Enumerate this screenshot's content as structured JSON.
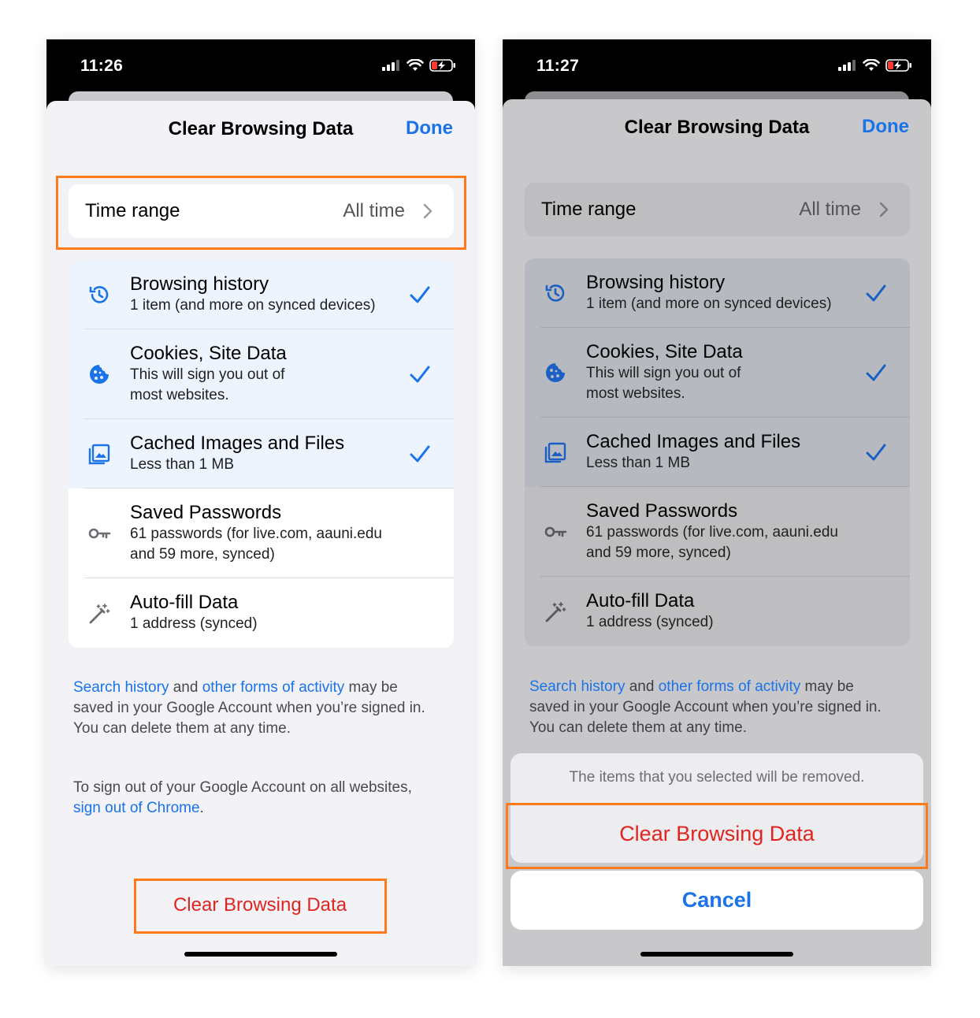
{
  "colors": {
    "accent_blue": "#1a73e8",
    "destructive_red": "#e0241f",
    "highlight_orange": "#ff7a1a"
  },
  "left": {
    "status": {
      "time": "11:26"
    },
    "header": {
      "title": "Clear Browsing Data",
      "done_label": "Done"
    },
    "time_range": {
      "label": "Time range",
      "value": "All time",
      "icon": "chevron-right-icon"
    },
    "items": [
      {
        "title": "Browsing history",
        "subtitle_lines": [
          "1 item (and more on synced devices)"
        ],
        "icon": "history-icon",
        "checked": true
      },
      {
        "title": "Cookies, Site Data",
        "subtitle_lines": [
          "This will sign you out of",
          "most websites."
        ],
        "icon": "cookie-icon",
        "checked": true
      },
      {
        "title": "Cached Images and Files",
        "subtitle_lines": [
          "Less than 1 MB"
        ],
        "icon": "image-icon",
        "checked": true
      },
      {
        "title": "Saved Passwords",
        "subtitle_lines": [
          "61 passwords (for live.com, aauni.edu",
          "and 59 more, synced)"
        ],
        "icon": "key-icon",
        "checked": false
      },
      {
        "title": "Auto-fill Data",
        "subtitle_lines": [
          "1 address (synced)"
        ],
        "icon": "magic-wand-icon",
        "checked": false
      }
    ],
    "footer": {
      "link1": "Search history",
      "and": " and ",
      "link2": "other forms of activity",
      "rest1": " may be",
      "line2": "saved in your Google Account when you’re signed in.",
      "line3": "You can delete them at any time.",
      "signout_line1": "To sign out of your Google Account on all websites,",
      "signout_link": "sign out of Chrome",
      "signout_end": "."
    },
    "clear_button": "Clear Browsing Data"
  },
  "right": {
    "status": {
      "time": "11:27"
    },
    "header": {
      "title": "Clear Browsing Data",
      "done_label": "Done"
    },
    "time_range": {
      "label": "Time range",
      "value": "All time",
      "icon": "chevron-right-icon"
    },
    "items": [
      {
        "title": "Browsing history",
        "subtitle_lines": [
          "1 item (and more on synced devices)"
        ],
        "icon": "history-icon",
        "checked": true
      },
      {
        "title": "Cookies, Site Data",
        "subtitle_lines": [
          "This will sign you out of",
          "most websites."
        ],
        "icon": "cookie-icon",
        "checked": true
      },
      {
        "title": "Cached Images and Files",
        "subtitle_lines": [
          "Less than 1 MB"
        ],
        "icon": "image-icon",
        "checked": true
      },
      {
        "title": "Saved Passwords",
        "subtitle_lines": [
          "61 passwords (for live.com, aauni.edu",
          "and 59 more, synced)"
        ],
        "icon": "key-icon",
        "checked": false
      },
      {
        "title": "Auto-fill Data",
        "subtitle_lines": [
          "1 address (synced)"
        ],
        "icon": "magic-wand-icon",
        "checked": false
      }
    ],
    "footer": {
      "link1": "Search history",
      "and": " and ",
      "link2": "other forms of activity",
      "rest1": " may be",
      "line2": "saved in your Google Account when you’re signed in.",
      "line3": "You can delete them at any time."
    },
    "action_sheet": {
      "message": "The items that you selected will be removed.",
      "confirm": "Clear Browsing Data",
      "cancel": "Cancel"
    }
  }
}
